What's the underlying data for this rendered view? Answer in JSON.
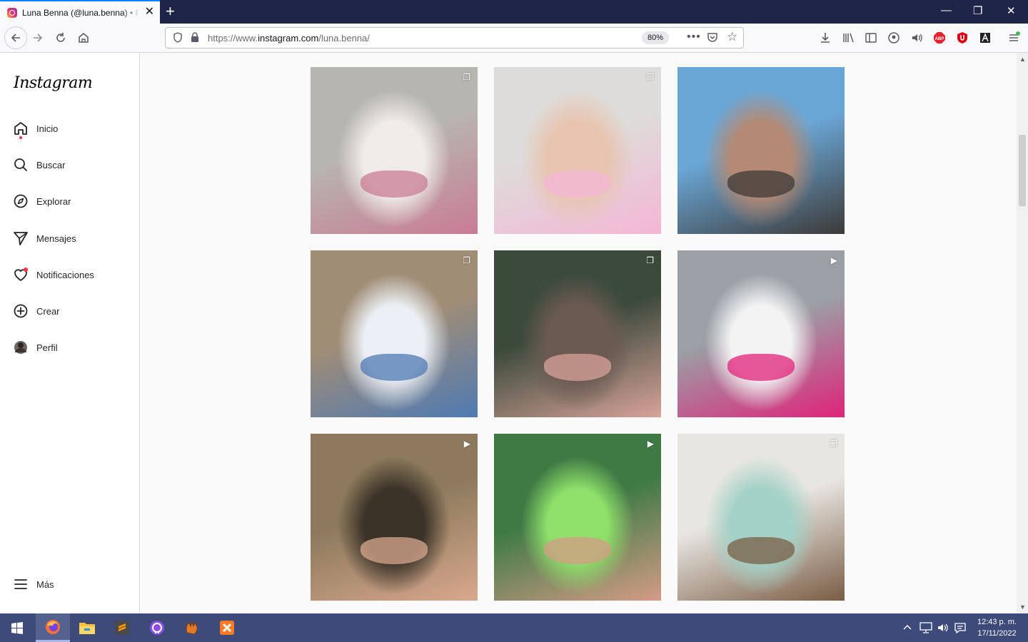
{
  "browser": {
    "tab_title": "Luna Benna (@luna.benna) • Fotos y videos de Instagram",
    "url_prefix": "https://www.",
    "url_host": "instagram.com",
    "url_path": "/luna.benna/",
    "zoom": "80%"
  },
  "sidebar": {
    "logo": "Instagram",
    "items": [
      {
        "label": "Inicio",
        "icon": "home-icon"
      },
      {
        "label": "Buscar",
        "icon": "search-icon"
      },
      {
        "label": "Explorar",
        "icon": "compass-icon"
      },
      {
        "label": "Mensajes",
        "icon": "paper-plane-icon"
      },
      {
        "label": "Notificaciones",
        "icon": "heart-icon"
      },
      {
        "label": "Crear",
        "icon": "plus-square-icon"
      },
      {
        "label": "Perfil",
        "icon": "avatar"
      }
    ],
    "more_label": "Más"
  },
  "posts": [
    {
      "type": "carousel",
      "colors": [
        "#b7b5b0",
        "#f0ede8",
        "#c97b95"
      ]
    },
    {
      "type": "carousel",
      "colors": [
        "#dedcda",
        "#e8c4b0",
        "#f4b6d5"
      ]
    },
    {
      "type": "photo",
      "colors": [
        "#6aa7d6",
        "#b58a74",
        "#3d3a38"
      ]
    },
    {
      "type": "carousel",
      "colors": [
        "#a08d76",
        "#ecf0f6",
        "#4f7ab3"
      ]
    },
    {
      "type": "carousel",
      "colors": [
        "#3c4a3c",
        "#6b5a52",
        "#d8a39a"
      ]
    },
    {
      "type": "reel",
      "colors": [
        "#9aa0a6",
        "#f3f3f3",
        "#e0237a"
      ]
    },
    {
      "type": "reel",
      "colors": [
        "#8d7a5c",
        "#3b3328",
        "#d9a88e"
      ]
    },
    {
      "type": "reel",
      "colors": [
        "#3f7a45",
        "#8ee06a",
        "#d49c86"
      ]
    },
    {
      "type": "carousel",
      "colors": [
        "#e8e6e2",
        "#a3d1c6",
        "#7a5d44"
      ]
    }
  ],
  "taskbar": {
    "time": "12:43 p. m.",
    "date": "17/11/2022"
  }
}
